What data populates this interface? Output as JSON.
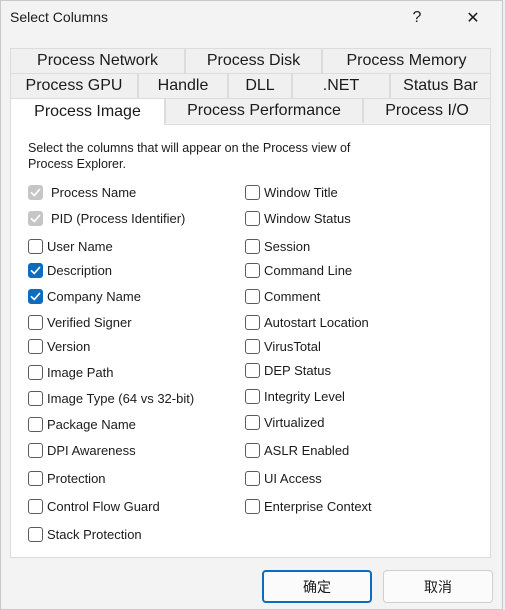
{
  "window": {
    "title": "Select Columns",
    "help_glyph": "?",
    "close_glyph": "✕"
  },
  "tabs": {
    "row1": [
      "Process Network",
      "Process Disk",
      "Process Memory"
    ],
    "row2": [
      "Process GPU",
      "Handle",
      "DLL",
      ".NET",
      "Status Bar"
    ],
    "row3": [
      "Process Image",
      "Process Performance",
      "Process I/O"
    ],
    "active": "Process Image"
  },
  "panel": {
    "description": "Select the columns that will appear on the Process view of Process Explorer.",
    "left": [
      {
        "label": "Process Name",
        "checked": true,
        "disabled": true
      },
      {
        "label": "PID (Process Identifier)",
        "checked": true,
        "disabled": true
      },
      {
        "label": "User Name",
        "checked": false,
        "disabled": false
      },
      {
        "label": "Description",
        "checked": true,
        "disabled": false
      },
      {
        "label": "Company Name",
        "checked": true,
        "disabled": false
      },
      {
        "label": "Verified Signer",
        "checked": false,
        "disabled": false
      },
      {
        "label": "Version",
        "checked": false,
        "disabled": false
      },
      {
        "label": "Image Path",
        "checked": false,
        "disabled": false
      },
      {
        "label": "Image Type (64 vs 32-bit)",
        "checked": false,
        "disabled": false
      },
      {
        "label": "Package Name",
        "checked": false,
        "disabled": false
      },
      {
        "label": "DPI Awareness",
        "checked": false,
        "disabled": false
      },
      {
        "label": "Protection",
        "checked": false,
        "disabled": false
      },
      {
        "label": "Control Flow Guard",
        "checked": false,
        "disabled": false
      },
      {
        "label": "Stack Protection",
        "checked": false,
        "disabled": false
      }
    ],
    "right": [
      {
        "label": "Window Title",
        "checked": false,
        "disabled": false
      },
      {
        "label": "Window Status",
        "checked": false,
        "disabled": false
      },
      {
        "label": "Session",
        "checked": false,
        "disabled": false
      },
      {
        "label": "Command Line",
        "checked": false,
        "disabled": false
      },
      {
        "label": "Comment",
        "checked": false,
        "disabled": false
      },
      {
        "label": "Autostart Location",
        "checked": false,
        "disabled": false
      },
      {
        "label": "VirusTotal",
        "checked": false,
        "disabled": false
      },
      {
        "label": "DEP Status",
        "checked": false,
        "disabled": false
      },
      {
        "label": "Integrity Level",
        "checked": false,
        "disabled": false
      },
      {
        "label": "Virtualized",
        "checked": false,
        "disabled": false
      },
      {
        "label": "ASLR Enabled",
        "checked": false,
        "disabled": false
      },
      {
        "label": "UI Access",
        "checked": false,
        "disabled": false
      },
      {
        "label": "Enterprise Context",
        "checked": false,
        "disabled": false
      }
    ]
  },
  "buttons": {
    "ok": "确定",
    "cancel": "取消"
  },
  "colors": {
    "accent": "#0f6cbd",
    "disabled_check": "#c6c6c6"
  }
}
